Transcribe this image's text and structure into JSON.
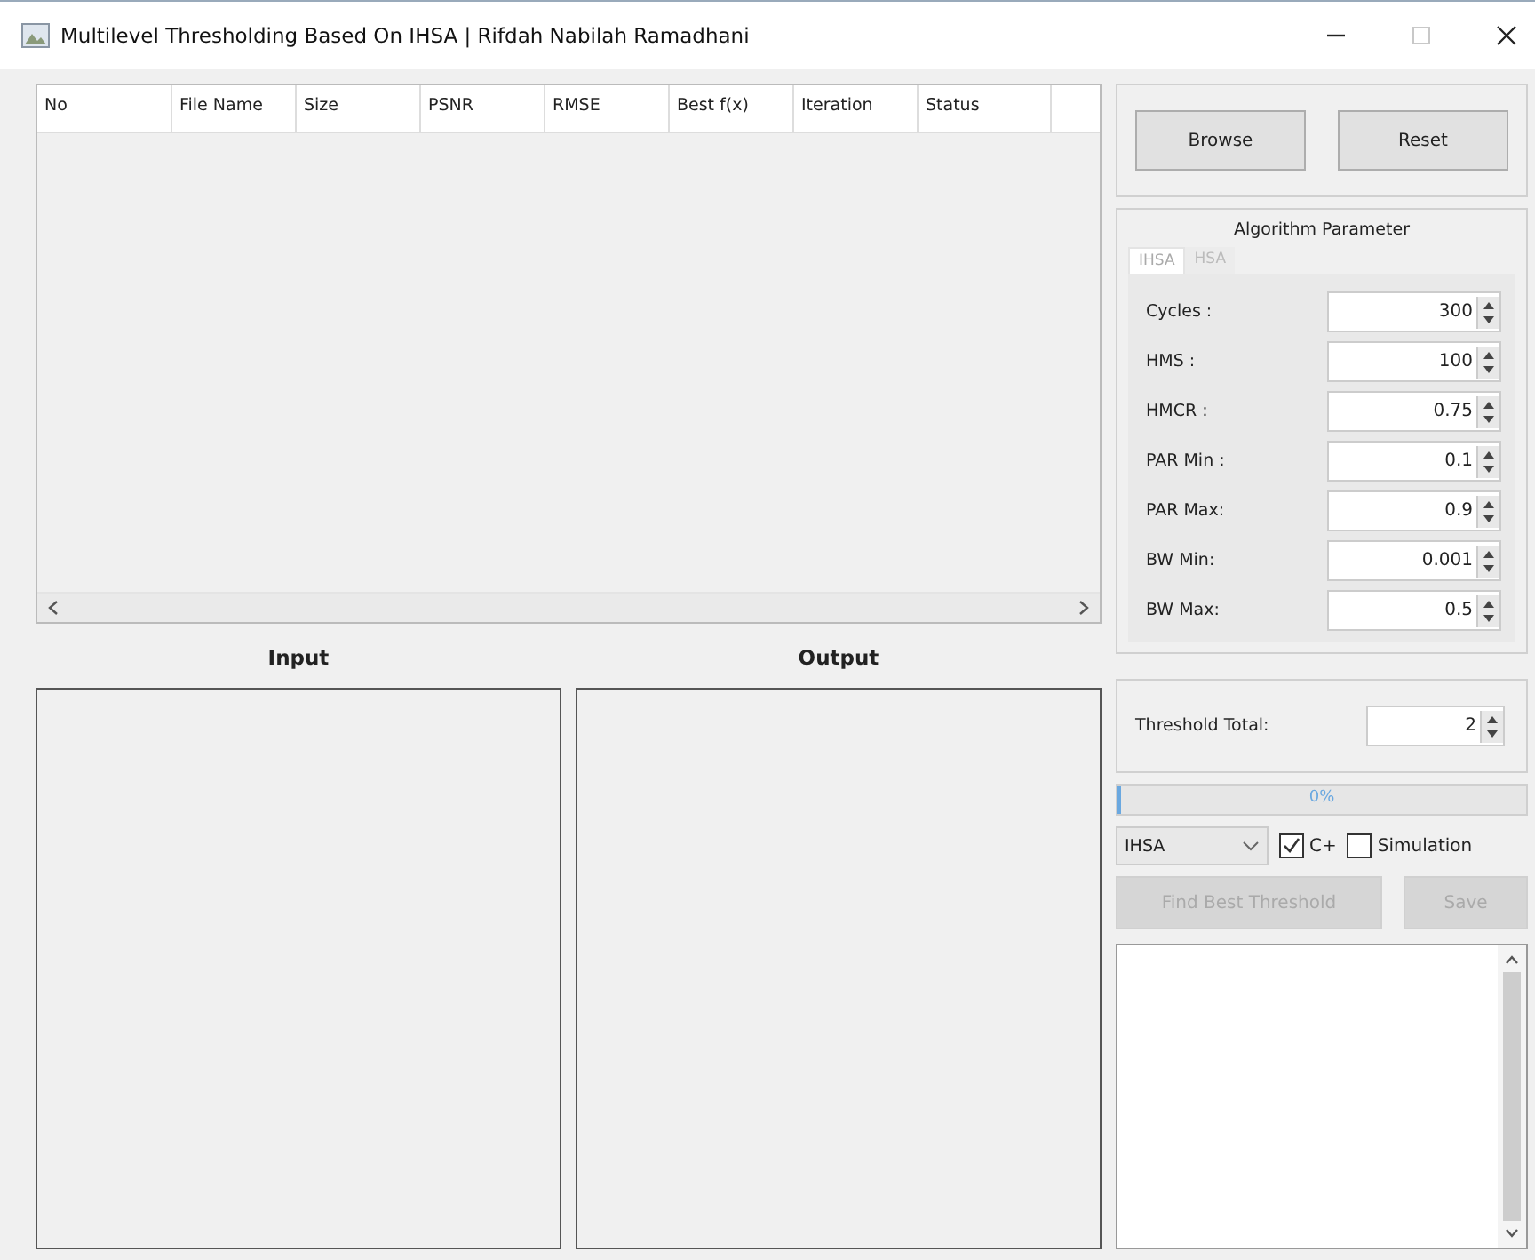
{
  "window": {
    "title": "Multilevel Thresholding Based On IHSA | Rifdah Nabilah Ramadhani"
  },
  "table": {
    "columns": [
      "No",
      "File Name",
      "Size",
      "PSNR",
      "RMSE",
      "Best f(x)",
      "Iteration",
      "Status"
    ]
  },
  "image_panels": [
    {
      "label": "Input"
    },
    {
      "label": "Output"
    }
  ],
  "buttons_top": [
    {
      "label": "Browse",
      "disabled": false
    },
    {
      "label": "Reset",
      "disabled": false
    }
  ],
  "algorithm_parameter": {
    "title": "Algorithm Parameter",
    "tabs": [
      {
        "label": "IHSA",
        "selected": true
      },
      {
        "label": "HSA",
        "selected": false
      }
    ],
    "fields": [
      {
        "label": "Cycles :",
        "value": "300"
      },
      {
        "label": "HMS :",
        "value": "100"
      },
      {
        "label": "HMCR :",
        "value": "0.75"
      },
      {
        "label": "PAR Min :",
        "value": "0.1"
      },
      {
        "label": "PAR Max:",
        "value": "0.9"
      },
      {
        "label": "BW Min:",
        "value": "0.001"
      },
      {
        "label": "BW Max:",
        "value": "0.5"
      }
    ]
  },
  "threshold": {
    "label": "Threshold Total:",
    "value": "2"
  },
  "progress": {
    "level": 0,
    "text": "0%"
  },
  "algorithm_select": {
    "value": "IHSA"
  },
  "checkboxes": [
    {
      "label": "C+",
      "checked": true
    },
    {
      "label": "Simulation",
      "checked": false
    }
  ],
  "buttons_bottom": [
    {
      "label": "Find Best Threshold",
      "disabled": true
    },
    {
      "label": "Save",
      "disabled": true
    }
  ]
}
